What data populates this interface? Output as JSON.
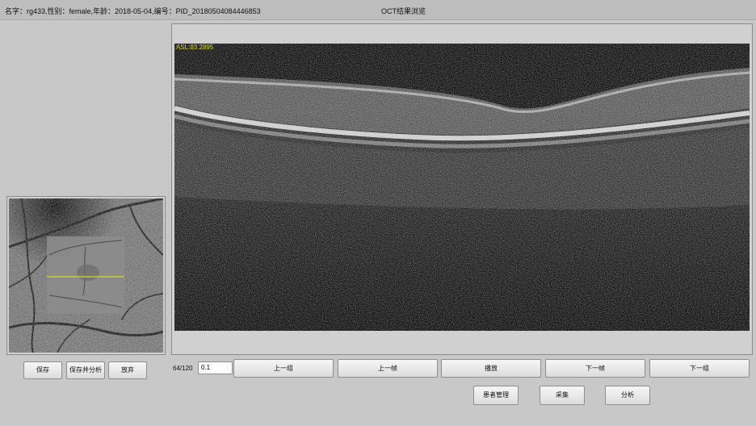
{
  "header": {
    "patient_info": "名字：rg433,性别：female,年龄：2018-05-04,编号：PID_20180504084446853",
    "window_title": "OCT结果浏览"
  },
  "oct": {
    "asl_label": "ASL:83.2895"
  },
  "left_buttons": {
    "save": "保存",
    "save_analyze": "保存并分析",
    "discard": "放弃"
  },
  "navigation": {
    "frame_count": "64/120",
    "input_value": "0.1",
    "prev_group": "上一组",
    "prev_frame": "上一帧",
    "play": "播放",
    "next_frame": "下一帧",
    "next_group": "下一组"
  },
  "bottom_buttons": {
    "patient_management": "患者管理",
    "capture": "采集",
    "analyze": "分析"
  }
}
